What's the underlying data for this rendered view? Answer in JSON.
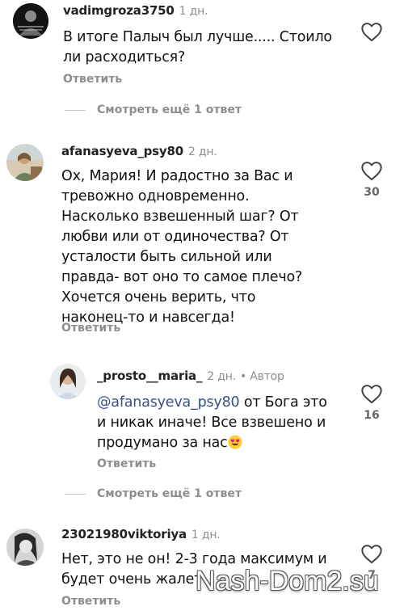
{
  "comments": [
    {
      "username": "vadimgroza3750",
      "time": "1 дн.",
      "lines": [
        "В итоге Палыч был лучше..... Стоило",
        "ли расходиться?"
      ],
      "reply_label": "Ответить",
      "likes": ""
    },
    {
      "username": "afanasyeva_psy80",
      "time": "2 дн.",
      "lines": [
        "Ох, Мария! И радостно за Вас и",
        "тревожно одновременно.",
        "Насколько взвешенный шаг? От",
        "любви или от одиночества? От",
        "усталости быть сильной или",
        "правда-  вот оно то самое плечо?",
        "Хочется очень верить, что",
        "наконец-то и навсегда!"
      ],
      "reply_label": "Ответить",
      "likes": "30"
    },
    {
      "username": "_prosto__maria_",
      "time": "2 дн.",
      "author_tag": "• Автор",
      "mention": "@afanasyeva_psy80",
      "line1_rest": " от Бога это",
      "lines": [
        "и никак иначе! Все взвешено и",
        "продумано за нас"
      ],
      "reply_label": "Ответить",
      "likes": "16"
    },
    {
      "username": "23021980viktoriya",
      "time": "1 дн.",
      "lines": [
        "Нет, это не он! 2-3 года максимум и",
        "будет очень жалет"
      ],
      "reply_label": "Ответить",
      "likes": "7"
    }
  ],
  "view_more_1": "Смотреть ещё 1 ответ",
  "view_more_2": "Смотреть ещё 1 ответ",
  "watermark": "Nash-Dom2.su",
  "icons": {
    "like": "heart-outline-icon",
    "emoji": "smiling-face-with-heart-eyes"
  },
  "colors": {
    "muted": "#8e8e8e",
    "mention": "#385185",
    "text": "#111111"
  }
}
